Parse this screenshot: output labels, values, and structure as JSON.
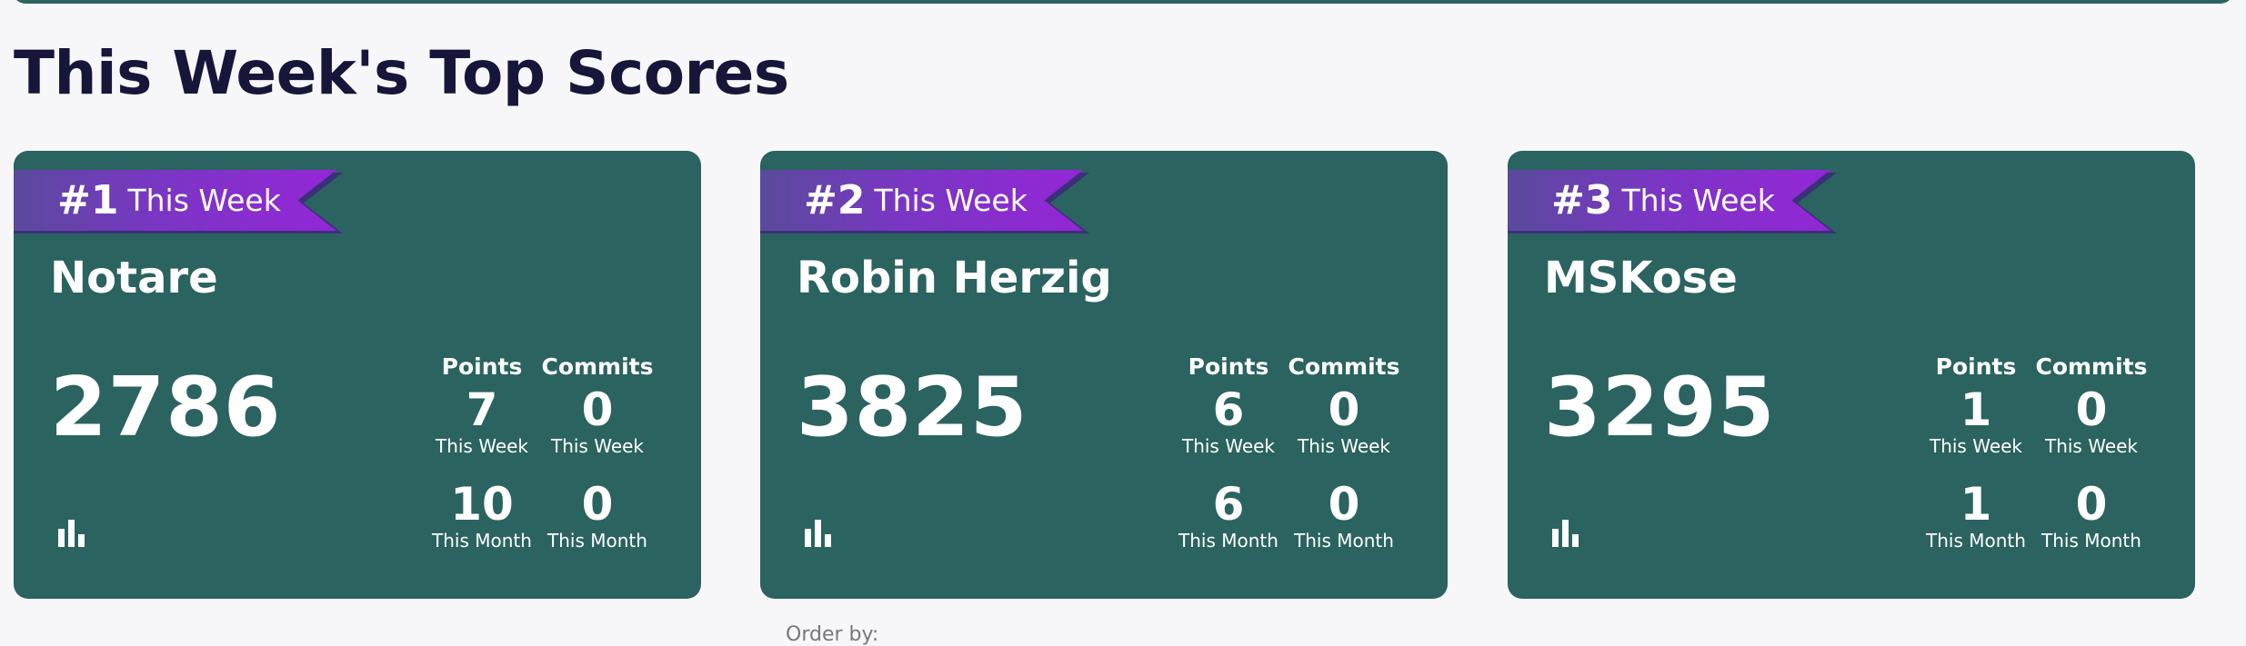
{
  "page": {
    "title": "This Week's Top Scores",
    "order_by_label": "Order by:"
  },
  "colors": {
    "card_bg": "#2a6360",
    "ribbon_start": "#5a4a9c",
    "ribbon_end": "#9426d6",
    "title_text": "#16163a",
    "page_bg": "#f7f7fa"
  },
  "stat_headers": {
    "points": "Points",
    "commits": "Commits",
    "this_week": "This Week",
    "this_month": "This Month"
  },
  "cards": [
    {
      "rank": "#1",
      "rank_label": "This Week",
      "name": "Notare",
      "score": "2786",
      "points_week": "7",
      "commits_week": "0",
      "points_month": "10",
      "commits_month": "0",
      "icon": "bar-chart-icon"
    },
    {
      "rank": "#2",
      "rank_label": "This Week",
      "name": "Robin Herzig",
      "score": "3825",
      "points_week": "6",
      "commits_week": "0",
      "points_month": "6",
      "commits_month": "0",
      "icon": "bar-chart-icon"
    },
    {
      "rank": "#3",
      "rank_label": "This Week",
      "name": "MSKose",
      "score": "3295",
      "points_week": "1",
      "commits_week": "0",
      "points_month": "1",
      "commits_month": "0",
      "icon": "bar-chart-icon"
    }
  ]
}
